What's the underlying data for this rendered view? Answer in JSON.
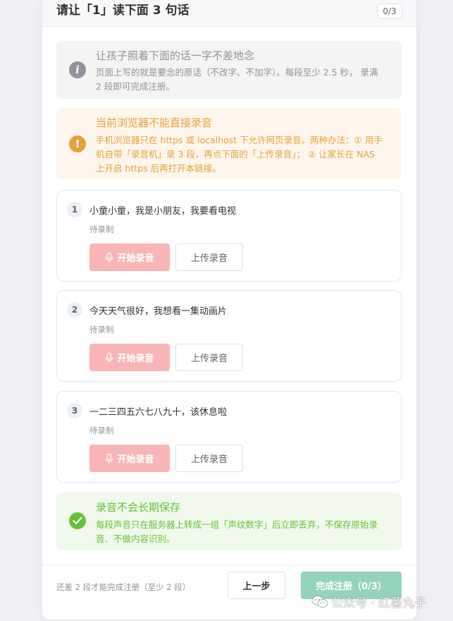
{
  "dialog": {
    "title": "请让「1」读下面 3 句话",
    "count_badge": "0/3"
  },
  "info_alert": {
    "icon": "info-icon",
    "title": "让孩子照着下面的话一字不差地念",
    "desc": "页面上写的就是要念的原话（不改字、不加字）。每段至少 2.5 秒， 录满 2 段即可完成注册。"
  },
  "warn_alert": {
    "icon": "warning-icon",
    "title": "当前浏览器不能直接录音",
    "desc": "手机浏览器只在 https 或 localhost 下允许网页录音。两种办法：① 用手机自带「录音机」录 3 段，再点下面的「上传录音」； ② 让家长在 NAS 上开启 https 后再打开本链接。"
  },
  "sentences": [
    {
      "num": "1",
      "text": "小童小童，我是小朋友，我要看电视",
      "status": "待录制",
      "record_label": "开始录音",
      "upload_label": "上传录音"
    },
    {
      "num": "2",
      "text": "今天天气很好，我想看一集动画片",
      "status": "待录制",
      "record_label": "开始录音",
      "upload_label": "上传录音"
    },
    {
      "num": "3",
      "text": "一二三四五六七八九十，该休息啦",
      "status": "待录制",
      "record_label": "开始录音",
      "upload_label": "上传录音"
    }
  ],
  "success_alert": {
    "icon": "check-icon",
    "title": "录音不会长期保存",
    "desc": "每段声音只在服务器上转成一组「声纹数字」后立即丢弃，不保存原始录音、不做内容识别。"
  },
  "footer": {
    "hint": "还差 2 段才能完成注册（至少 2 段）",
    "prev_label": "上一步",
    "finish_label": "完成注册（0/3）"
  },
  "watermark": {
    "icon": "wechat-icon",
    "text": "公众号 · 红薯丸子"
  },
  "colors": {
    "record_button": "#fab6b6",
    "finish_button": "#95d4bb",
    "warning": "#e6a23c",
    "success": "#67c23a",
    "info": "#909399"
  }
}
